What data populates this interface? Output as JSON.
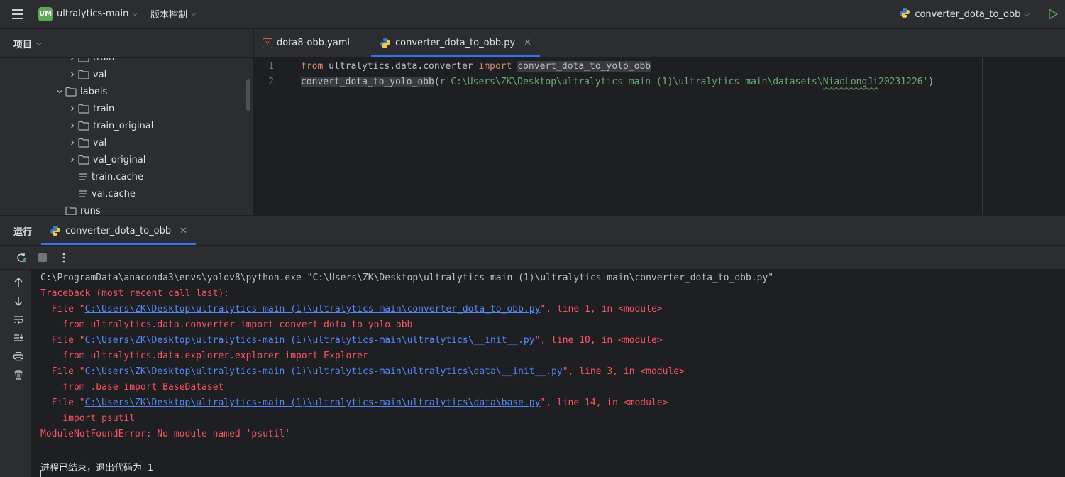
{
  "topbar": {
    "project_badge": "UM",
    "project_name": "ultralytics-main",
    "vcs_label": "版本控制",
    "run_config": "converter_dota_to_obb"
  },
  "project_panel": {
    "title": "项目",
    "tree": [
      {
        "label": "train",
        "kind": "folder",
        "expanded": false,
        "level": 2,
        "partial": true
      },
      {
        "label": "val",
        "kind": "folder",
        "expanded": false,
        "level": 2
      },
      {
        "label": "labels",
        "kind": "folder",
        "expanded": true,
        "level": 1
      },
      {
        "label": "train",
        "kind": "folder",
        "expanded": false,
        "level": 2
      },
      {
        "label": "train_original",
        "kind": "folder",
        "expanded": false,
        "level": 2
      },
      {
        "label": "val",
        "kind": "folder",
        "expanded": false,
        "level": 2
      },
      {
        "label": "val_original",
        "kind": "folder",
        "expanded": false,
        "level": 2
      },
      {
        "label": "train.cache",
        "kind": "file",
        "level": 2
      },
      {
        "label": "val.cache",
        "kind": "file",
        "level": 2
      },
      {
        "label": "runs",
        "kind": "folder",
        "expanded": false,
        "level": 1,
        "partial": true
      }
    ]
  },
  "editor": {
    "tabs": [
      {
        "label": "dota8-obb.yaml",
        "icon": "yaml-icon",
        "active": false
      },
      {
        "label": "converter_dota_to_obb.py",
        "icon": "python-icon",
        "active": true
      }
    ],
    "lines": [
      {
        "num": "1",
        "kw1": "from",
        "mod": " ultralytics.data.converter ",
        "kw2": "import",
        "sp": " ",
        "name": "convert_dota_to_yolo_obb"
      },
      {
        "num": "2",
        "fn": "convert_dota_to_yolo_obb",
        "open": "(",
        "str_a": "r'C:\\Users\\ZK\\Desktop\\ultralytics-main (1)\\ultralytics-main\\datasets\\",
        "str_b": "NiaoLongJi",
        "str_c": "20231226'",
        "close": ")"
      }
    ]
  },
  "run_panel": {
    "title": "运行",
    "tab_label": "converter_dota_to_obb",
    "console": [
      {
        "type": "cmd",
        "text": "C:\\ProgramData\\anaconda3\\envs\\yolov8\\python.exe \"C:\\Users\\ZK\\Desktop\\ultralytics-main (1)\\ultralytics-main\\converter_dota_to_obb.py\""
      },
      {
        "type": "err",
        "text": "Traceback (most recent call last):"
      },
      {
        "type": "file",
        "pre": "  File \"",
        "link": "C:\\Users\\ZK\\Desktop\\ultralytics-main (1)\\ultralytics-main\\converter_dota_to_obb.py",
        "post": "\", line 1, in <module>"
      },
      {
        "type": "err",
        "text": "    from ultralytics.data.converter import convert_dota_to_yolo_obb"
      },
      {
        "type": "file",
        "pre": "  File \"",
        "link": "C:\\Users\\ZK\\Desktop\\ultralytics-main (1)\\ultralytics-main\\ultralytics\\__init__.py",
        "post": "\", line 10, in <module>"
      },
      {
        "type": "err",
        "text": "    from ultralytics.data.explorer.explorer import Explorer"
      },
      {
        "type": "file",
        "pre": "  File \"",
        "link": "C:\\Users\\ZK\\Desktop\\ultralytics-main (1)\\ultralytics-main\\ultralytics\\data\\__init__.py",
        "post": "\", line 3, in <module>"
      },
      {
        "type": "err",
        "text": "    from .base import BaseDataset"
      },
      {
        "type": "file",
        "pre": "  File \"",
        "link": "C:\\Users\\ZK\\Desktop\\ultralytics-main (1)\\ultralytics-main\\ultralytics\\data\\base.py",
        "post": "\", line 14, in <module>"
      },
      {
        "type": "err",
        "text": "    import psutil"
      },
      {
        "type": "err",
        "text": "ModuleNotFoundError: No module named 'psutil'"
      },
      {
        "type": "blank",
        "text": ""
      },
      {
        "type": "norm",
        "text": "进程已结束，退出代码为 1"
      }
    ]
  },
  "colors": {
    "accent": "#3574f0",
    "error": "#f75464",
    "link": "#548af7",
    "keyword": "#cf8e6d",
    "string": "#6aab73"
  }
}
